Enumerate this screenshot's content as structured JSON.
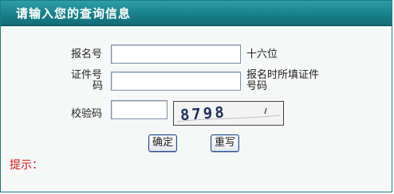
{
  "header": {
    "title": "请输入您的查询信息"
  },
  "form": {
    "reg_no": {
      "label": "报名号",
      "hint": "十六位",
      "value": ""
    },
    "id_no": {
      "label_line1": "证件号",
      "label_line2": "码",
      "hint_line1": "报名时所填证件",
      "hint_line2": "号码",
      "value": ""
    },
    "captcha": {
      "label": "校验码",
      "value": "",
      "image_text": "8798"
    }
  },
  "buttons": {
    "confirm": "确定",
    "reset": "重写"
  },
  "tip": {
    "label": "提示："
  }
}
